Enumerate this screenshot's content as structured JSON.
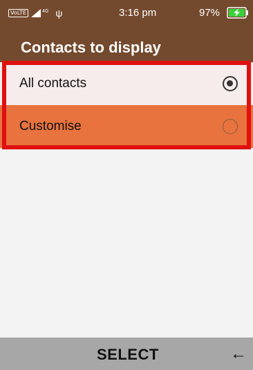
{
  "status_bar": {
    "volte": "VoLTE",
    "network": "4G",
    "usb_icon": "usb-icon",
    "time": "3:16 pm",
    "battery": "97%",
    "battery_icon": "battery-charging-icon"
  },
  "header": {
    "title": "Contacts to display"
  },
  "options": [
    {
      "label": "All contacts",
      "selected": true
    },
    {
      "label": "Customise",
      "selected": false
    }
  ],
  "softkeys": {
    "center": "SELECT",
    "right_icon": "back-arrow-icon",
    "right_glyph": "←"
  },
  "colors": {
    "header": "#744a2e",
    "focus": "#e8733e",
    "highlight_frame": "#e01010",
    "battery": "#3ad13a"
  }
}
